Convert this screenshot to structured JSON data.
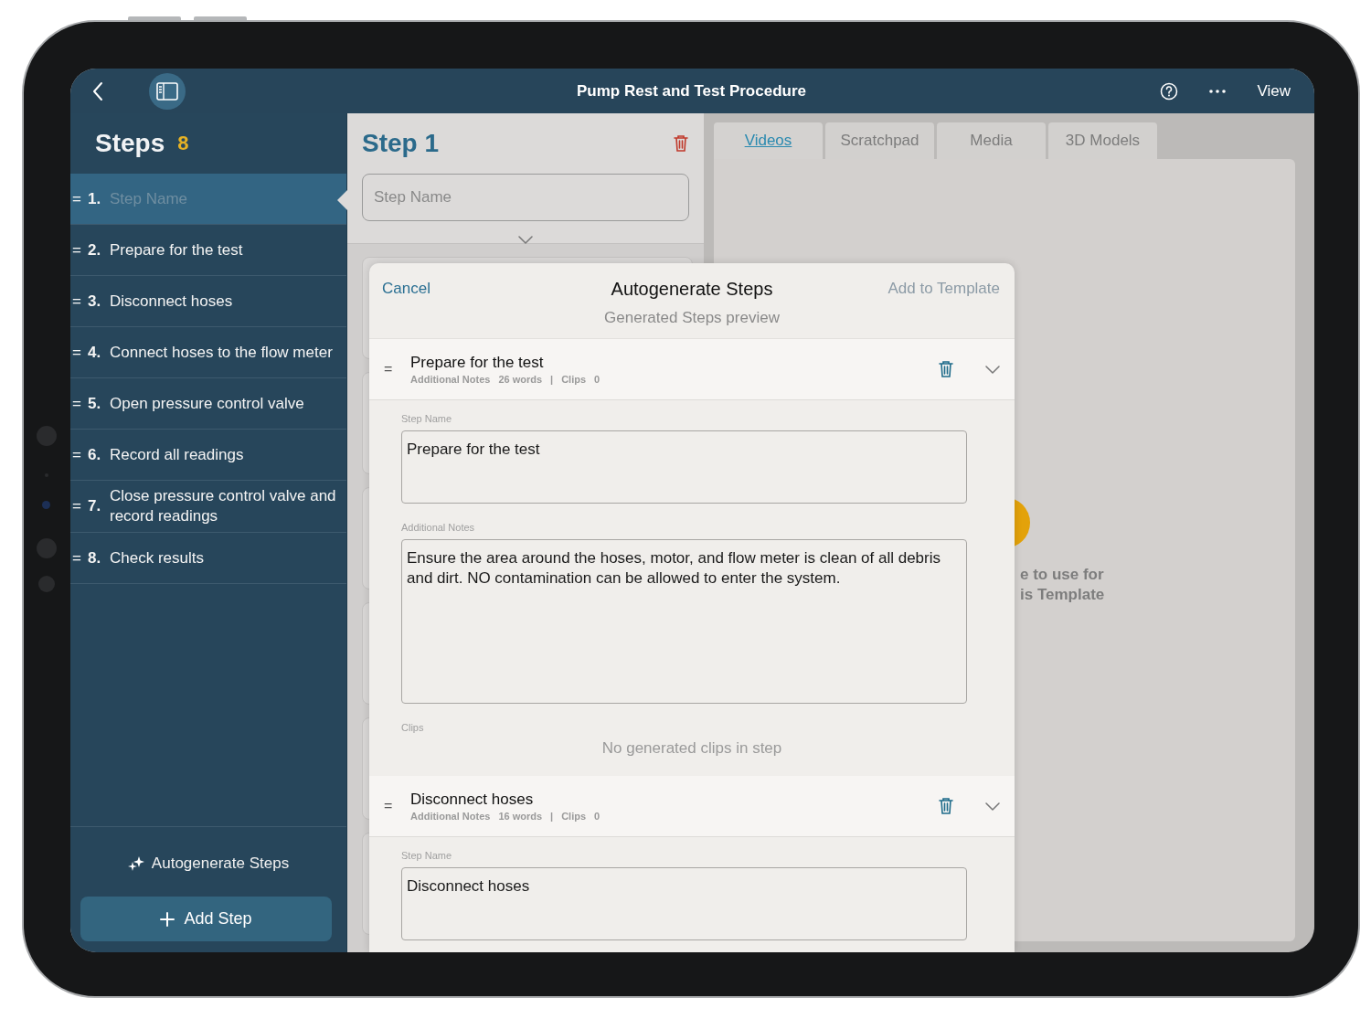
{
  "header": {
    "title": "Pump Rest and Test Procedure",
    "view": "View"
  },
  "sidebar": {
    "title": "Steps",
    "count": "8",
    "items": [
      {
        "handle": "=",
        "number": "1.",
        "placeholder": "Step Name",
        "selected": true
      },
      {
        "handle": "=",
        "number": "2.",
        "label": "Prepare for the test",
        "selected": false
      },
      {
        "handle": "=",
        "number": "3.",
        "label": "Disconnect hoses",
        "selected": false
      },
      {
        "handle": "=",
        "number": "4.",
        "label": "Connect hoses to the flow meter",
        "selected": false
      },
      {
        "handle": "=",
        "number": "5.",
        "label": "Open pressure control valve",
        "selected": false
      },
      {
        "handle": "=",
        "number": "6.",
        "label": "Record all readings",
        "selected": false
      },
      {
        "handle": "=",
        "number": "7.",
        "label": "Close pressure control valve and record readings",
        "selected": false
      },
      {
        "handle": "=",
        "number": "8.",
        "label": "Check results",
        "selected": false
      }
    ],
    "autogenerate": "Autogenerate Steps",
    "add_step": "Add Step"
  },
  "editor": {
    "title": "Step 1",
    "name_field": {
      "placeholder": "Step Name"
    }
  },
  "tabs": [
    {
      "label": "Videos",
      "selected": true
    },
    {
      "label": "Scratchpad",
      "selected": false
    },
    {
      "label": "Media",
      "selected": false
    },
    {
      "label": "3D Models",
      "selected": false
    }
  ],
  "media_panel": {
    "hint_lines": [
      "e to use for",
      "is Template"
    ]
  },
  "modal": {
    "cancel": "Cancel",
    "title": "Autogenerate Steps",
    "add": "Add to Template",
    "add_disabled": true,
    "subtitle": "Generated Steps preview",
    "steps": [
      {
        "handle": "=",
        "name": "Prepare for the test",
        "notes_label": "Additional Notes",
        "words": "26 words",
        "separator": "|",
        "clips_label": "Clips",
        "clips": "0",
        "step_name_label": "Step Name",
        "step_name": "Prepare for the test",
        "notes_field_label": "Additional Notes",
        "notes": "Ensure the area around the hoses, motor, and flow meter is clean of all debris and dirt. NO contamination can be allowed to enter the system.",
        "clips_section_label": "Clips",
        "clips_empty": "No generated clips in step"
      },
      {
        "handle": "=",
        "name": "Disconnect hoses",
        "notes_label": "Additional Notes",
        "words": "16 words",
        "separator": "|",
        "clips_label": "Clips",
        "clips": "0",
        "step_name_label": "Step Name",
        "step_name": "Disconnect hoses"
      }
    ]
  }
}
